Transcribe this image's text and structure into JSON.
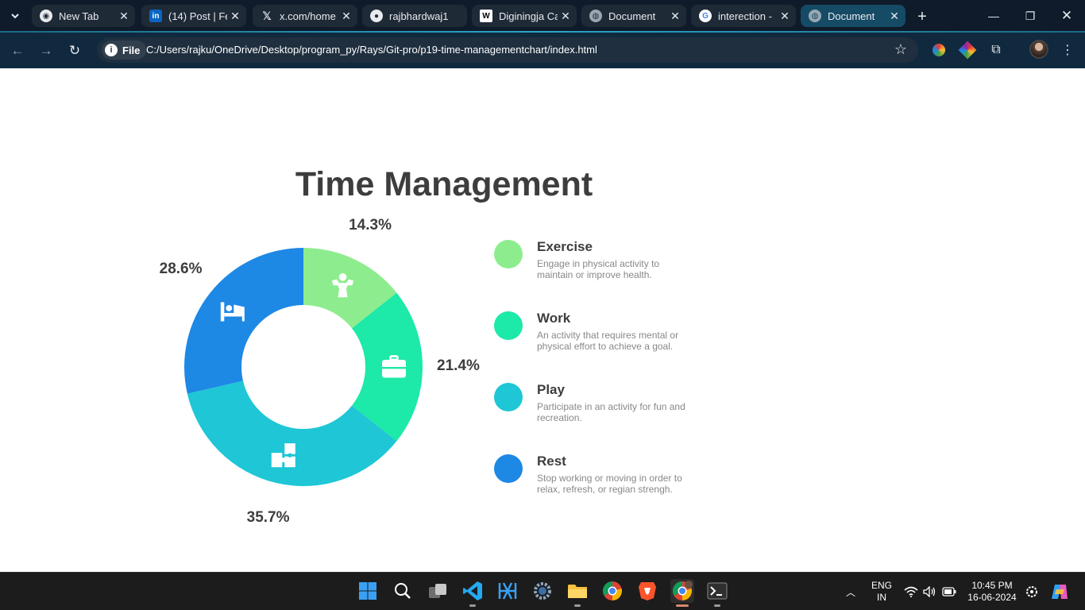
{
  "browser": {
    "tabs": [
      {
        "title": "New Tab",
        "icon": "chrome-icon"
      },
      {
        "title": "(14) Post | Fe",
        "icon": "linkedin-icon"
      },
      {
        "title": "x.com/home",
        "icon": "x-icon"
      },
      {
        "title": "rajbhardwaj1",
        "icon": "github-icon"
      },
      {
        "title": "Diginingja Car",
        "icon": "w-icon"
      },
      {
        "title": "Document",
        "icon": "globe-icon"
      },
      {
        "title": "interection -",
        "icon": "google-icon"
      },
      {
        "title": "Document",
        "icon": "globe-icon",
        "active": true
      }
    ],
    "address": {
      "chip_label": "File",
      "url": "C:/Users/rajku/OneDrive/Desktop/program_py/Rays/Git-pro/p19-time-managementchart/index.html"
    }
  },
  "page": {
    "title": "Time Management"
  },
  "chart_data": {
    "type": "pie",
    "title": "Time Management",
    "categories": [
      "Exercise",
      "Work",
      "Play",
      "Rest"
    ],
    "values": [
      14.3,
      21.4,
      35.7,
      28.6
    ],
    "labels": [
      "14.3%",
      "21.4%",
      "35.7%",
      "28.6%"
    ],
    "colors": [
      "#8ded8e",
      "#1de9a8",
      "#1ec6d6",
      "#1e88e5"
    ],
    "icons": [
      "strongman-icon",
      "briefcase-icon",
      "puzzle-icon",
      "bed-icon"
    ],
    "donut": true
  },
  "legend": [
    {
      "title": "Exercise",
      "desc": "Engage in physical activity to maintain or improve health.",
      "color": "#8ded8e"
    },
    {
      "title": "Work",
      "desc": "An activity that requires mental or physical effort to achieve a goal.",
      "color": "#1de9a8"
    },
    {
      "title": "Play",
      "desc": "Participate in an activity for fun and recreation.",
      "color": "#1ec6d6"
    },
    {
      "title": "Rest",
      "desc": "Stop working or moving in order to relax, refresh, or regian strengh.",
      "color": "#1e88e5"
    }
  ],
  "taskbar": {
    "language": {
      "line1": "ENG",
      "line2": "IN"
    },
    "clock": {
      "time": "10:45 PM",
      "date": "16-06-2024"
    }
  }
}
